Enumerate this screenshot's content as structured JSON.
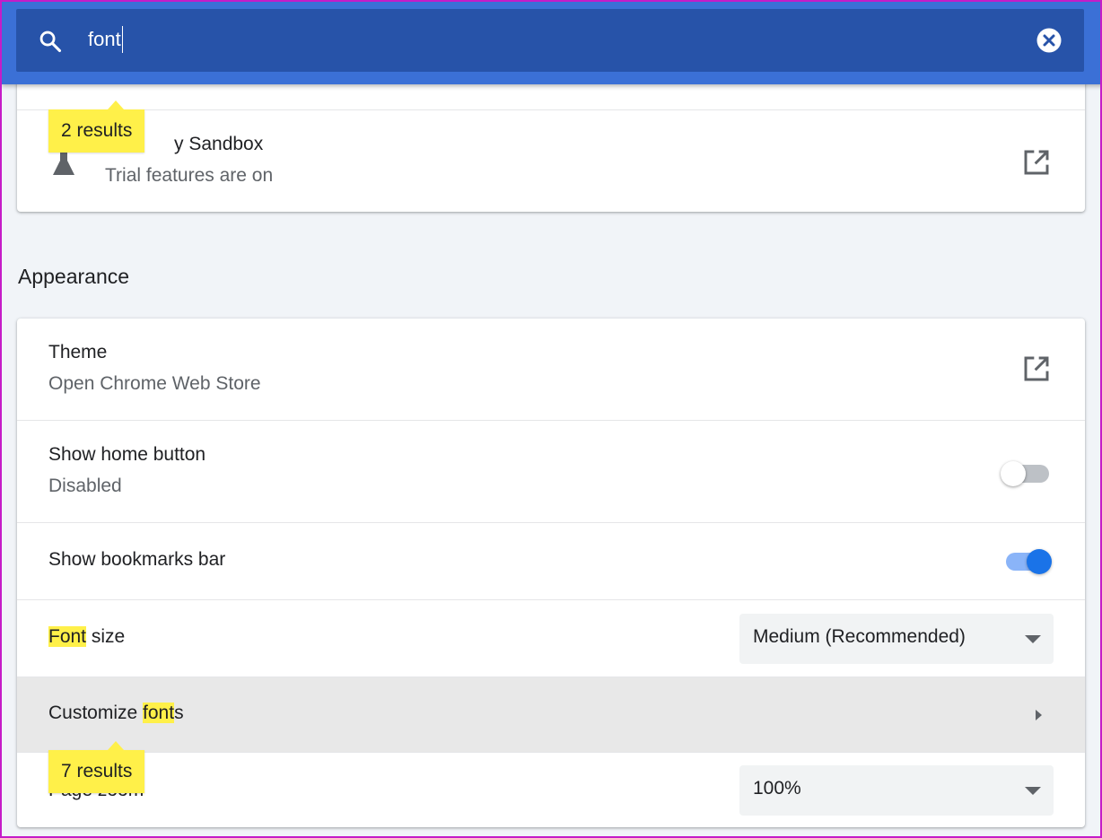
{
  "search": {
    "query": "font",
    "search_icon": "search-icon",
    "clear_icon": "clear-circle-icon"
  },
  "top_card": {
    "partial_row_text": "",
    "sandbox": {
      "title_visible": "y Sandbox",
      "subtitle": "Trial features are on",
      "icon": "flask-icon",
      "action_icon": "open-in-new-icon"
    }
  },
  "section": {
    "title": "Appearance"
  },
  "rows": {
    "theme": {
      "title": "Theme",
      "subtitle": "Open Chrome Web Store",
      "action_icon": "open-in-new-icon"
    },
    "home_button": {
      "title": "Show home button",
      "subtitle": "Disabled",
      "enabled": false
    },
    "bookmarks_bar": {
      "title": "Show bookmarks bar",
      "enabled": true
    },
    "font_size": {
      "title_highlight": "Font",
      "title_rest": " size",
      "value": "Medium (Recommended)"
    },
    "customize_fonts": {
      "title_prefix": "Customize ",
      "title_highlight": "font",
      "title_suffix": "s",
      "action_icon": "arrow-right-icon"
    },
    "page_zoom": {
      "title": "Page zoom",
      "value": "100%"
    }
  },
  "bubbles": {
    "top": "2 results",
    "bottom": "7 results"
  },
  "colors": {
    "topbar": "#3b70d6",
    "searchbox": "#2753a9",
    "highlight": "#fff049",
    "toggle_on": "#1a73e8",
    "border_frame": "#c51cc8"
  }
}
